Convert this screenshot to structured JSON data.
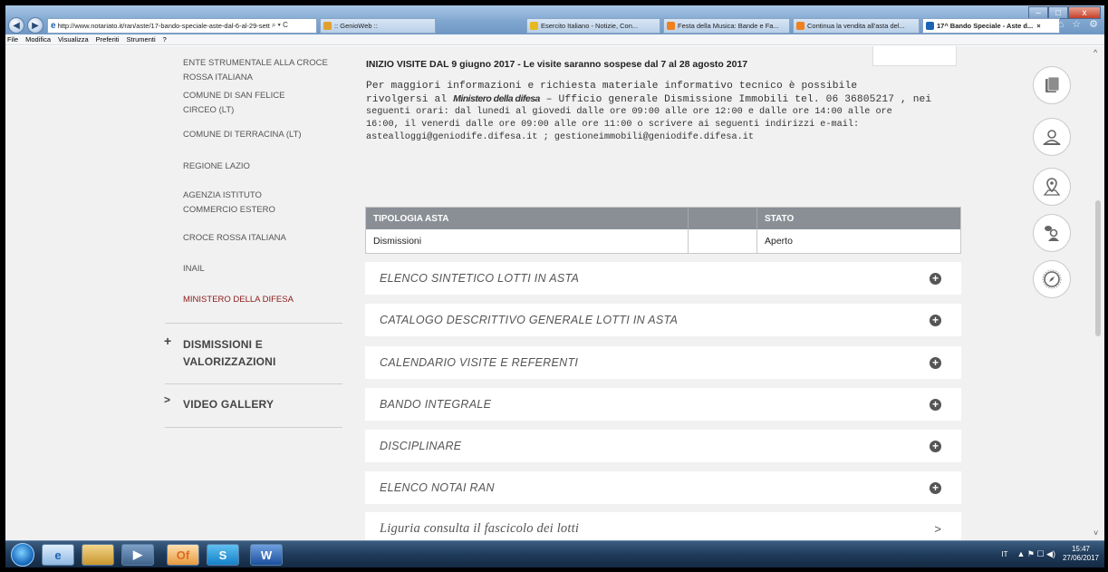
{
  "browser": {
    "address": "http://www.notariato.it/ran/aste/17-bando-speciale-aste-dal-6-al-29-sett",
    "address_domain": "notariato.it",
    "address_tools": "⌕ ▾ C",
    "tabs": [
      {
        "label": ":: GenioWeb ::",
        "color": "#e0a030"
      },
      {
        "label": "Esercito Italiano - Notizie, Con...",
        "color": "#e8b820"
      },
      {
        "label": "Festa della Musica: Bande e Fa...",
        "color": "#f08020"
      },
      {
        "label": "Continua la vendita all'asta del...",
        "color": "#f08020"
      },
      {
        "label": "17^ Bando Speciale - Aste d...",
        "color": "#1b63b5"
      }
    ],
    "tab_close": "×",
    "window_buttons": [
      "–",
      "□",
      "x"
    ],
    "right_icons": "⌂ ☆ ⚙",
    "menu": [
      "File",
      "Modifica",
      "Visualizza",
      "Preferiti",
      "Strumenti",
      "?"
    ]
  },
  "sidebar": {
    "items": [
      "ENTE STRUMENTALE ALLA CROCE ROSSA ITALIANA",
      "COMUNE DI SAN FELICE CIRCEO (LT)",
      "COMUNE DI TERRACINA (LT)",
      "REGIONE LAZIO",
      "AGENZIA ISTITUTO COMMERCIO ESTERO",
      "CROCE ROSSA ITALIANA",
      "INAIL",
      "MINISTERO DELLA DIFESA"
    ],
    "sections": [
      {
        "marker": "+",
        "label": "DISMISSIONI E VALORIZZAZIONI"
      },
      {
        "marker": ">",
        "label": "VIDEO GALLERY"
      }
    ]
  },
  "main": {
    "headline": "INIZIO VISITE DAL 9 giugno 2017 - Le visite saranno sospese dal 7 al 28 agosto  2017",
    "info_line1": "Per  maggiori  informazioni  e richiesta materiale informativo  tecnico è possibile",
    "info_line2_pre": "rivolgersi al ",
    "info_line2_mil": "Ministero della difesa",
    "info_line2_post": " –  Ufficio generale Dismissione Immobili tel. 06 36805217 , nei",
    "info_line3": "seguenti orari: dal lunedi al giovedi dalle ore 09:00 alle ore 12:00 e dalle ore 14:00 alle ore",
    "info_line4": "16:00, il venerdi dalle ore 09:00 alle ore 11:00  o scrivere ai seguenti indirizzi e-mail:",
    "info_line5": "astealloggi@geniodife.difesa.it ; gestioneimmobili@geniodife.difesa.it",
    "table": {
      "headers": [
        "TIPOLOGIA ASTA",
        "",
        "STATO"
      ],
      "row": [
        "Dismissioni",
        "",
        "Aperto"
      ]
    },
    "accordion": [
      "ELENCO SINTETICO LOTTI IN ASTA",
      "CATALOGO DESCRITTIVO GENERALE LOTTI IN ASTA",
      "CALENDARIO VISITE E REFERENTI",
      "BANDO INTEGRALE",
      "DISCIPLINARE",
      "ELENCO NOTAI RAN"
    ],
    "accordion_icon": "+",
    "link_item": "Liguria consulta il fascicolo dei lotti",
    "link_icon": ">"
  },
  "taskbar": {
    "apps": [
      "",
      "e",
      "",
      "▶",
      "Of",
      "S",
      "W"
    ],
    "lang": "IT",
    "tray_symbols": "▲  ⚑  ☐  ◀)",
    "time": "15:47",
    "date": "27/06/2017"
  },
  "scrollbar": {
    "up": "^",
    "down": "˅"
  }
}
